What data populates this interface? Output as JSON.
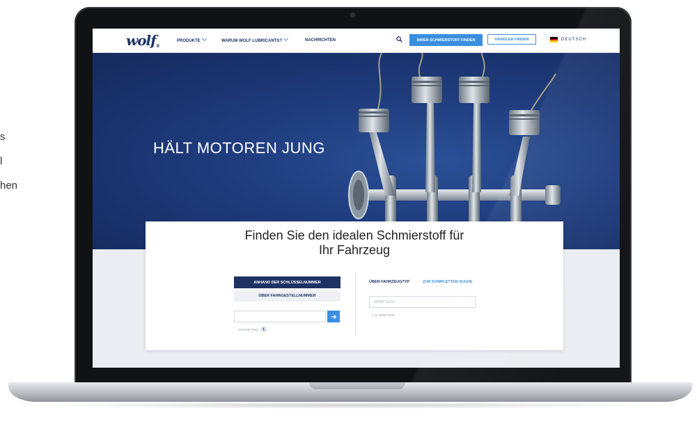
{
  "side_text": [
    "s",
    "l",
    "hen"
  ],
  "site": {
    "logo_text": "wolf",
    "logo_suffix": "®",
    "nav": [
      {
        "label": "PRODUKTE",
        "has_dropdown": true
      },
      {
        "label": "WARUM WOLF LUBRICANTS?",
        "has_dropdown": true
      },
      {
        "label": "NACHRICHTEN",
        "has_dropdown": false
      }
    ],
    "primary_button": "IHREN SCHMIERSTOFF FINDEN",
    "outline_button": "HÄNDLER FINDEN",
    "language": "DEUTSCH",
    "icons": {
      "search": "search-icon",
      "flag": "german-flag-icon",
      "arrow": "arrow-right-icon",
      "info": "info-icon"
    }
  },
  "hero": {
    "title": "HÄLT MOTOREN JUNG"
  },
  "finder": {
    "title_line1": "Finden Sie den idealen Schmierstoff für",
    "title_line2": "Ihr Fahrzeug",
    "tab_active": "ANHAND DER SCHLÜSSELNUMMER",
    "tab_inactive": "ÜBER FAHRGESTELLNUMMER",
    "key_input_value": "",
    "hint_text": "WHERE FIND",
    "vehicle_type_label": "ÜBER FAHRZEUGTYP",
    "full_search_link": "ZUR KOMPLETTEN SUCHE",
    "vehicle_placeholder": "BMW 520d",
    "vehicle_example": "z. B. BMW 520d"
  },
  "colors": {
    "brand_navy": "#1e3363",
    "accent_blue": "#3a8ee0",
    "hero_blue": "#1e3b7c",
    "laptop_bezel": "#111214"
  }
}
